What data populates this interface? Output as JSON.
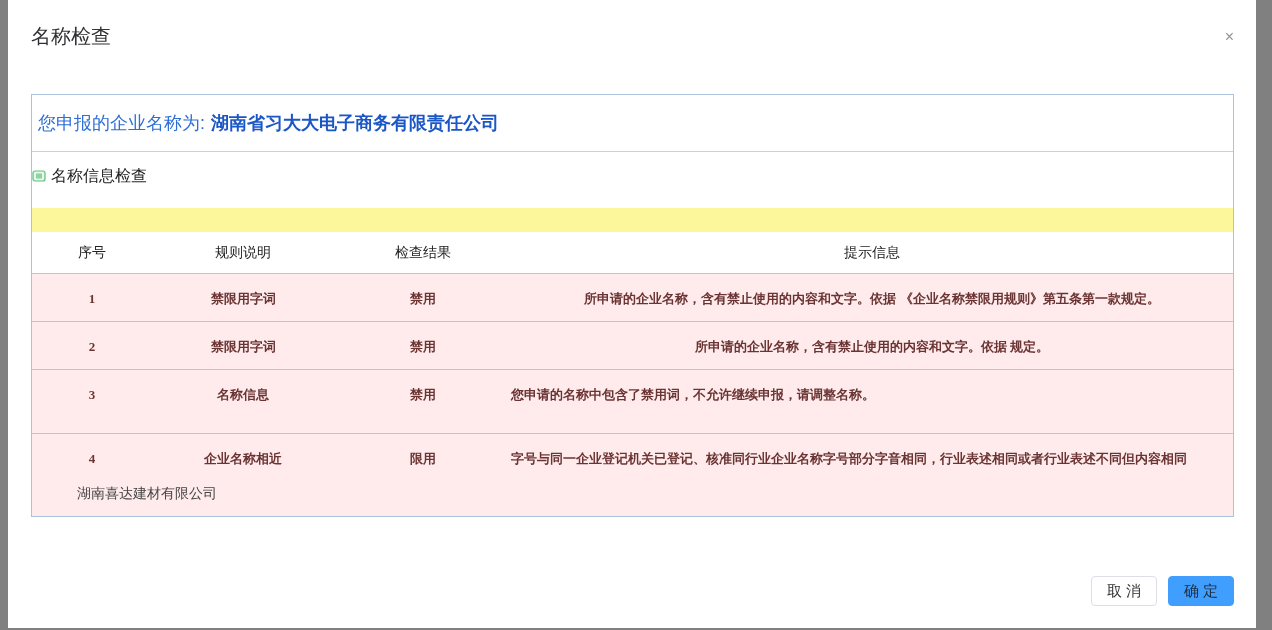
{
  "dialog": {
    "title": "名称检查",
    "close": "×"
  },
  "applied_name": {
    "label": "您申报的企业名称为:",
    "value": "湖南省习大大电子商务有限责任公司"
  },
  "section": {
    "title": "名称信息检查"
  },
  "table": {
    "columns": [
      "序号",
      "规则说明",
      "检查结果",
      "提示信息"
    ],
    "rows": [
      {
        "kind": "centered",
        "index": "1",
        "rule": "禁限用字词",
        "result": "禁用",
        "message": "所申请的企业名称，含有禁止使用的内容和文字。依据 《企业名称禁限用规则》第五条第一款规定。"
      },
      {
        "kind": "centered",
        "index": "2",
        "rule": "禁限用字词",
        "result": "禁用",
        "message": "所申请的企业名称，含有禁止使用的内容和文字。依据 规定。"
      },
      {
        "kind": "left",
        "index": "3",
        "rule": "名称信息",
        "result": "禁用",
        "message": "您申请的名称中包含了禁用词，不允许继续申报，请调整名称。"
      },
      {
        "kind": "left",
        "index": "4",
        "rule": "企业名称相近",
        "result": "限用",
        "message": "字号与同一企业登记机关已登记、核准同行业企业名称字号部分字音相同，行业表述相同或者行业表述不同但内容相同",
        "similar_company": "湖南喜达建材有限公司"
      }
    ]
  },
  "buttons": [
    {
      "kind": "secondary",
      "label": "取 消"
    },
    {
      "kind": "primary",
      "label": "确 定"
    }
  ]
}
